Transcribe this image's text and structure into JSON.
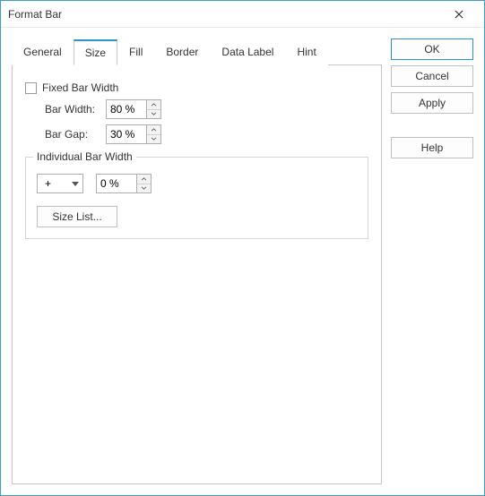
{
  "window": {
    "title": "Format Bar"
  },
  "tabs": [
    {
      "label": "General"
    },
    {
      "label": "Size"
    },
    {
      "label": "Fill"
    },
    {
      "label": "Border"
    },
    {
      "label": "Data Label"
    },
    {
      "label": "Hint"
    }
  ],
  "active_tab": "Size",
  "size_tab": {
    "fixed_bar_width_label": "Fixed Bar Width",
    "fixed_bar_width_checked": false,
    "bar_width_label": "Bar Width:",
    "bar_width_value": "80 %",
    "bar_gap_label": "Bar Gap:",
    "bar_gap_value": "30 %",
    "individual_group_label": "Individual Bar Width",
    "individual_selector_value": "+",
    "individual_value": "0 %",
    "size_list_label": "Size List..."
  },
  "buttons": {
    "ok": "OK",
    "cancel": "Cancel",
    "apply": "Apply",
    "help": "Help"
  }
}
